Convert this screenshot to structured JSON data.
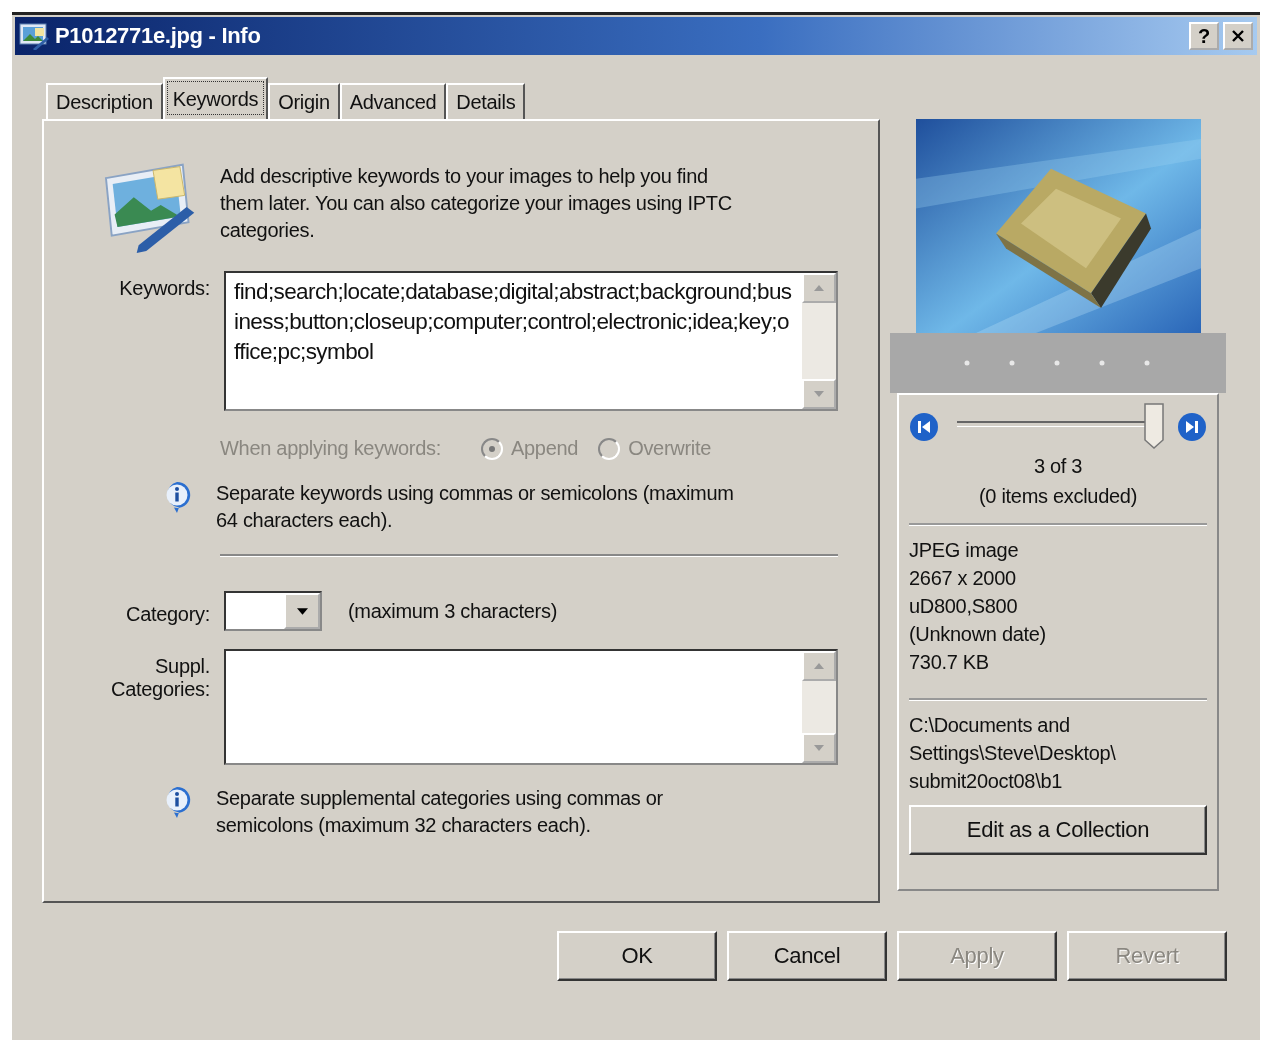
{
  "window": {
    "title": "P1012771e.jpg - Info",
    "help": "?"
  },
  "tabs": [
    {
      "label": "Description",
      "selected": false
    },
    {
      "label": "Keywords",
      "selected": true
    },
    {
      "label": "Origin",
      "selected": false
    },
    {
      "label": "Advanced",
      "selected": false
    },
    {
      "label": "Details",
      "selected": false
    }
  ],
  "intro": "Add descriptive keywords to your images to help you find them later. You can also categorize your images using IPTC categories.",
  "keywords": {
    "label": "Keywords:",
    "value": "find;search;locate;database;digital;abstract;background;business;button;closeup;computer;control;electronic;idea;key;office;pc;symbol"
  },
  "apply_mode": {
    "label": "When applying keywords:",
    "disabled": true,
    "options": [
      {
        "label": "Append",
        "selected": true
      },
      {
        "label": "Overwrite",
        "selected": false
      }
    ]
  },
  "keywords_note": "Separate keywords using commas or semicolons (maximum 64 characters each).",
  "category": {
    "label": "Category:",
    "hint": "(maximum 3 characters)"
  },
  "supplemental": {
    "label": "Suppl. Categories:"
  },
  "supplemental_note": "Separate supplemental categories using commas or semicolons (maximum 32 characters each).",
  "preview": {
    "kind": "picture",
    "position": "3 of 3",
    "excluded": "(0 items excluded)",
    "slider": {
      "level": 1
    }
  },
  "file_info": [
    "JPEG image",
    "2667 x 2000",
    "uD800,S800",
    "(Unknown date)",
    "730.7 KB"
  ],
  "path": [
    "C:\\Documents and",
    "Settings\\Steve\\Desktop\\",
    "submit20oct08\\b1"
  ],
  "collection_button": "Edit as a Collection",
  "buttons": [
    {
      "label": "OK",
      "disabled": false
    },
    {
      "label": "Cancel",
      "disabled": false
    },
    {
      "label": "Apply",
      "disabled": true
    },
    {
      "label": "Revert",
      "disabled": true
    }
  ]
}
